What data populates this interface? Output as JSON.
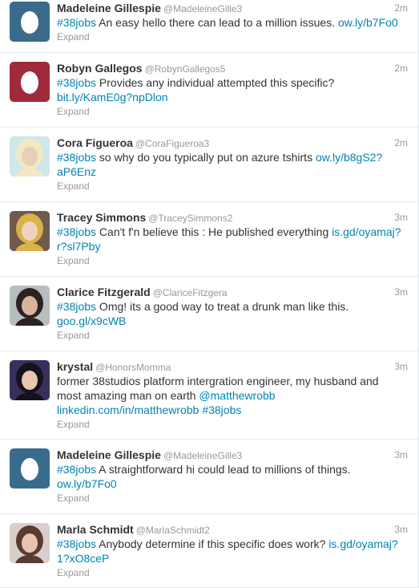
{
  "tweets": [
    {
      "fullname": "Madeleine Gillespie",
      "username": "@MadeleineGille3",
      "time": "2m",
      "avatar": {
        "type": "egg",
        "bg": "#3b6b8c"
      },
      "lines": [
        [
          {
            "t": "#38jobs",
            "link": true
          },
          {
            "t": " An easy hello there can lead to a million issues. "
          },
          {
            "t": "ow.ly/b7Fo0",
            "link": true
          }
        ]
      ],
      "expand": "Expand"
    },
    {
      "fullname": "Robyn Gallegos",
      "username": "@RobynGallegos5",
      "time": "2m",
      "avatar": {
        "type": "egg",
        "bg": "#a02a3c"
      },
      "lines": [
        [
          {
            "t": "#38jobs",
            "link": true
          },
          {
            "t": " Provides any individual attempted this specific?"
          }
        ],
        [
          {
            "t": "bit.ly/KamE0g?npDlon",
            "link": true
          }
        ]
      ],
      "expand": "Expand"
    },
    {
      "fullname": "Cora Figueroa",
      "username": "@CoraFigueroa3",
      "time": "2m",
      "avatar": {
        "type": "photo",
        "bg": "#cfe6ea",
        "accent": "#f2e8c4",
        "skin": "#e8d0b8"
      },
      "lines": [
        [
          {
            "t": "#38jobs",
            "link": true
          },
          {
            "t": " so why do you typically put on azure tshirts "
          },
          {
            "t": "ow.ly/b8gS2?",
            "link": true
          }
        ],
        [
          {
            "t": "aP6Enz",
            "link": true
          }
        ]
      ],
      "expand": "Expand"
    },
    {
      "fullname": "Tracey Simmons",
      "username": "@TraceySimmons2",
      "time": "3m",
      "avatar": {
        "type": "photo",
        "bg": "#6f5a4c",
        "accent": "#d9b24a",
        "skin": "#f0d3bf"
      },
      "lines": [
        [
          {
            "t": "#38jobs",
            "link": true
          },
          {
            "t": " Can't f'n believe this : He published everything "
          },
          {
            "t": "is.gd/oyamaj?",
            "link": true
          }
        ],
        [
          {
            "t": "r?sl7Pby",
            "link": true
          }
        ]
      ],
      "expand": "Expand"
    },
    {
      "fullname": "Clarice Fitzgerald",
      "username": "@ClariceFitzgera",
      "time": "3m",
      "avatar": {
        "type": "photo",
        "bg": "#b8bdc0",
        "accent": "#2a2322",
        "skin": "#d8b49c"
      },
      "lines": [
        [
          {
            "t": "#38jobs",
            "link": true
          },
          {
            "t": " Omg! its a good way to treat a drunk man like this."
          }
        ],
        [
          {
            "t": "goo.gl/x9cWB",
            "link": true
          }
        ]
      ],
      "expand": "Expand"
    },
    {
      "fullname": "krystal",
      "username": "@HonorsMomma",
      "time": "3m",
      "avatar": {
        "type": "photo",
        "bg": "#3a2f5c",
        "accent": "#15121c",
        "skin": "#e9c6b2"
      },
      "lines": [
        [
          {
            "t": "former 38studios platform intergration engineer, my husband and"
          }
        ],
        [
          {
            "t": "most amazing man on earth "
          },
          {
            "t": "@matthewrobb",
            "link": true
          }
        ],
        [
          {
            "t": "linkedin.com/in/matthewrobb",
            "link": true
          },
          {
            "t": " "
          },
          {
            "t": "#38jobs",
            "link": true
          }
        ]
      ],
      "expand": "Expand"
    },
    {
      "fullname": "Madeleine Gillespie",
      "username": "@MadeleineGille3",
      "time": "3m",
      "avatar": {
        "type": "egg",
        "bg": "#3b6b8c"
      },
      "lines": [
        [
          {
            "t": "#38jobs",
            "link": true
          },
          {
            "t": " A straightforward hi could lead to millions of things."
          }
        ],
        [
          {
            "t": "ow.ly/b7Fo0",
            "link": true
          }
        ]
      ],
      "expand": "Expand"
    },
    {
      "fullname": "Marla Schmidt",
      "username": "@MarlaSchmidt2",
      "time": "3m",
      "avatar": {
        "type": "photo",
        "bg": "#d8cfcc",
        "accent": "#5a3a33",
        "skin": "#e6c4b0"
      },
      "lines": [
        [
          {
            "t": "#38jobs",
            "link": true
          },
          {
            "t": " Anybody determine if this specific does work? "
          },
          {
            "t": "is.gd/oyamaj?",
            "link": true
          }
        ],
        [
          {
            "t": "1?xO8ceP",
            "link": true
          }
        ]
      ],
      "expand": "Expand"
    }
  ]
}
